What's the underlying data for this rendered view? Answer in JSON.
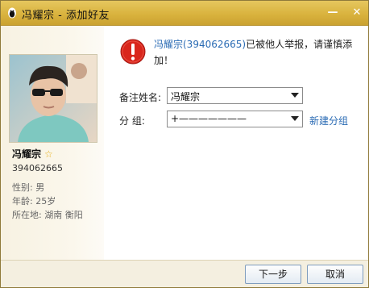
{
  "window": {
    "title": "冯耀宗 - 添加好友",
    "min_symbol": "—",
    "close_symbol": "✕"
  },
  "profile": {
    "name": "冯耀宗",
    "qq_number": "394062665",
    "gender": "性别: 男",
    "age": "年龄: 25岁",
    "location": "所在地: 湖南  衡阳"
  },
  "warning": {
    "user": "冯耀宗(394062665)",
    "message": "已被他人举报，请谨慎添加！"
  },
  "form": {
    "remark_label": "备注姓名:",
    "remark_value": "冯耀宗",
    "group_label": "分      组:",
    "group_value": "+———————",
    "new_group_link": "新建分组"
  },
  "buttons": {
    "next": "下一步",
    "cancel": "取消"
  },
  "colors": {
    "titlebar": "#d8b13c",
    "link": "#2a6bb4",
    "warning_red": "#d9261c"
  }
}
